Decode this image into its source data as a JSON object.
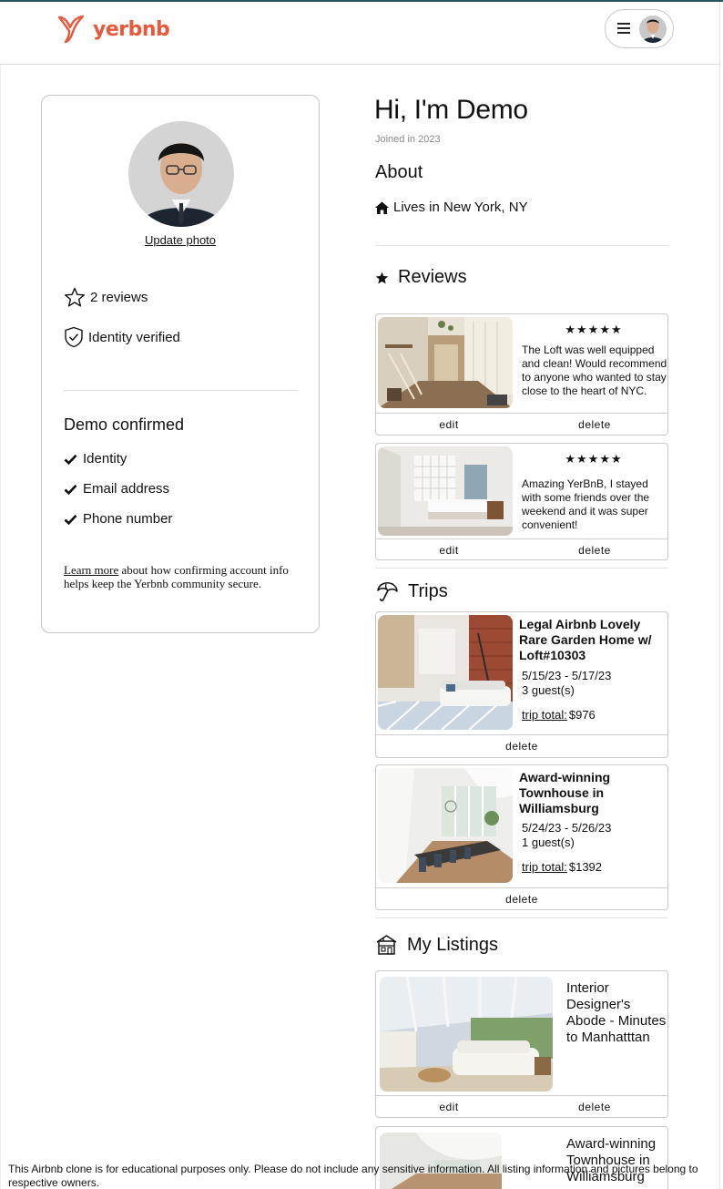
{
  "header": {
    "logo_text": "yerbnb",
    "brand_color": "#e55a3b",
    "menu_icon": "hamburger-icon"
  },
  "profile": {
    "update_photo": "Update photo",
    "reviews_count": "2 reviews",
    "identity_verified": "Identity verified",
    "confirmed_title": "Demo confirmed",
    "confirmed_items": [
      "Identity",
      "Email address",
      "Phone number"
    ],
    "learn_more_link": "Learn more",
    "learn_more_text": " about how confirming account info helps keep the Yerbnb community secure."
  },
  "main": {
    "title": "Hi, I'm Demo",
    "joined": "Joined in 2023",
    "about_title": "About",
    "lives_in": "Lives in New York, NY",
    "reviews_title": "Reviews",
    "trips_title": "Trips",
    "listings_title": "My Listings"
  },
  "reviews": [
    {
      "stars": "★★★★★",
      "text": "The Loft was well equipped and clean! Would recommend to anyone who wanted to stay close to the heart of NYC.",
      "edit": "edit",
      "delete": "delete"
    },
    {
      "stars": "★★★★★",
      "text": "Amazing YerBnB, I stayed with some friends over the weekend and it was super convenient!",
      "edit": "edit",
      "delete": "delete"
    }
  ],
  "trips": [
    {
      "title": "Legal Airbnb Lovely Rare Garden Home w/ Loft#10303",
      "dates": "5/15/23 - 5/17/23",
      "guests": "3 guest(s)",
      "total_label": "trip total:",
      "total_value": "$976",
      "delete": "delete"
    },
    {
      "title": "Award-winning Townhouse in Williamsburg",
      "dates": "5/24/23 - 5/26/23",
      "guests": "1 guest(s)",
      "total_label": "trip total:",
      "total_value": "$1392",
      "delete": "delete"
    }
  ],
  "listings": [
    {
      "title": "Interior Designer's Abode - Minutes to Manhatttan",
      "edit": "edit",
      "delete": "delete"
    },
    {
      "title": "Award-winning Townhouse in Williamsburg"
    }
  ],
  "footer": {
    "disclaimer": "This Airbnb clone is for educational purposes only. Please do not include any sensitive information. All listing information and pictures belong to respective owners."
  }
}
